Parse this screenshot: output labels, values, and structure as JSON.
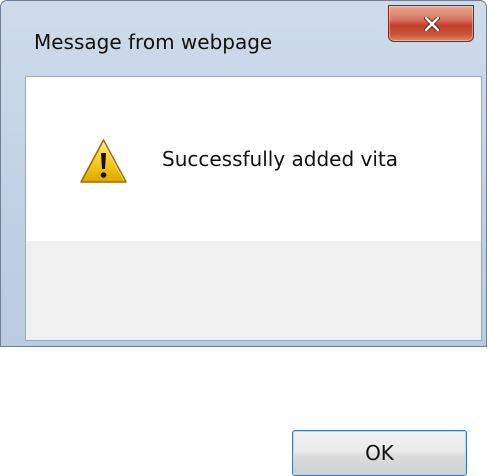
{
  "dialog": {
    "title": "Message from webpage",
    "message": "Successfully added vita",
    "ok_label": "OK"
  },
  "icons": {
    "close": "close-icon",
    "warning": "warning-icon"
  },
  "colors": {
    "close_button": "#c4402a",
    "warning_fill": "#f5c518",
    "ok_border": "#3c7fb1"
  }
}
